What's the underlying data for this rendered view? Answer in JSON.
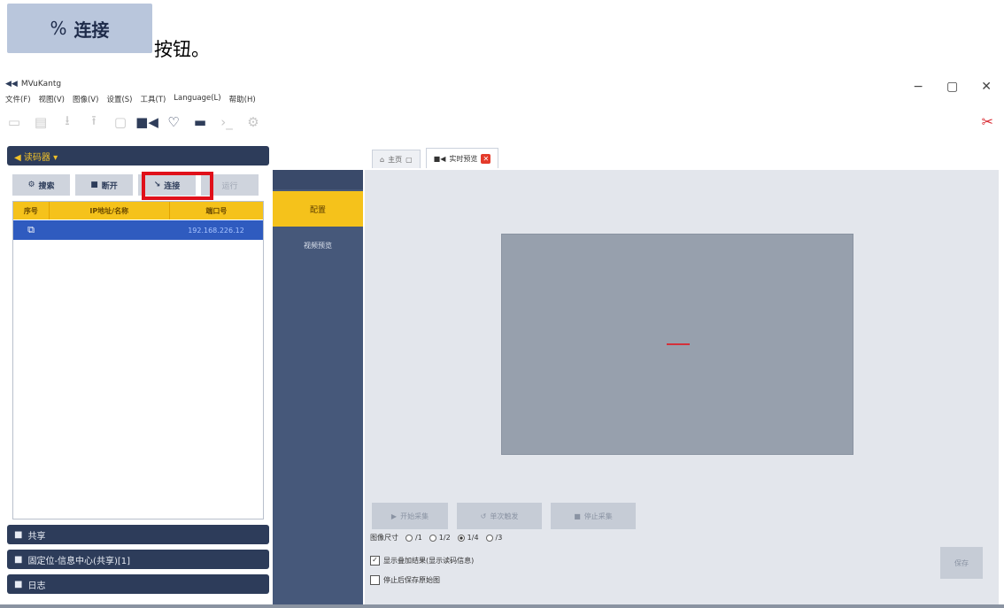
{
  "instruction": {
    "button_icon": "link-icon",
    "button_label": "连接",
    "suffix": "按钮。"
  },
  "window": {
    "title": "MVuKantg",
    "controls": [
      "−",
      "▢",
      "✕"
    ]
  },
  "menu": [
    "文件(F)",
    "视图(V)",
    "图像(V)",
    "设置(S)",
    "工具(T)",
    "Language(L)",
    "帮助(H)"
  ],
  "left_panel": {
    "header": "读码器 ▾",
    "buttons": [
      {
        "icon": "gear-icon",
        "label": "搜索"
      },
      {
        "icon": "stop-icon",
        "label": "断开"
      },
      {
        "icon": "link-icon",
        "label": "连接"
      },
      {
        "label": "运行"
      }
    ],
    "columns": [
      "序号",
      "IP地址/名称",
      "端口号"
    ],
    "rows": [
      {
        "status_icon": "connected-icon",
        "name": "",
        "port": "192.168.226.12"
      }
    ],
    "sections": [
      "共享",
      "固定位-信息中心(共享)[1]",
      "日志"
    ]
  },
  "nav": {
    "active": "配置",
    "items": [
      "视频预览"
    ]
  },
  "tabs": [
    {
      "label": "主页",
      "icon": "home-icon"
    },
    {
      "label": "实时预览",
      "icon": "camera-icon",
      "active": true
    }
  ],
  "content": {
    "controls": [
      "开始采集",
      "单次触发",
      "停止采集"
    ],
    "size_label": "图像尺寸",
    "size_options": [
      "/1",
      "1/2",
      "1/4",
      "/3"
    ],
    "size_selected": "1/4",
    "check1": "显示叠加结果(显示读码信息)",
    "check2": "停止后保存原始图",
    "side_button": "保存"
  }
}
